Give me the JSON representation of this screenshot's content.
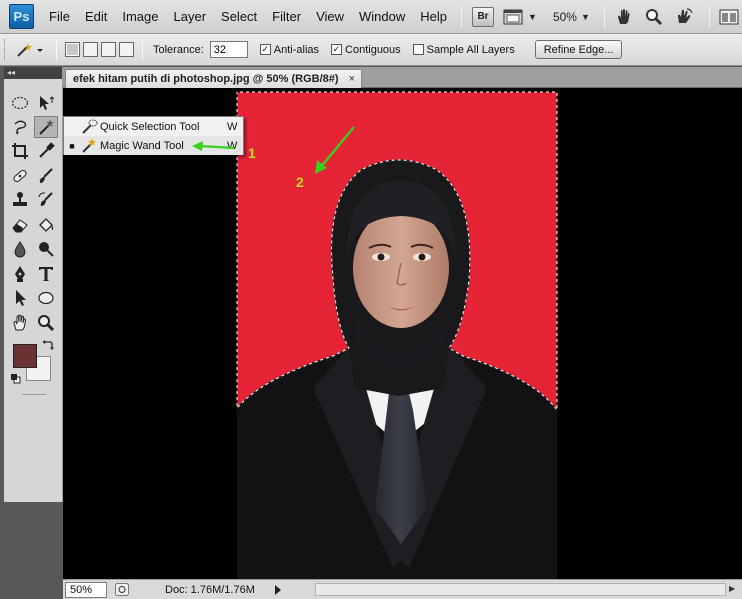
{
  "app": {
    "logo": "Ps"
  },
  "menu": [
    "File",
    "Edit",
    "Image",
    "Layer",
    "Select",
    "Filter",
    "View",
    "Window",
    "Help"
  ],
  "menubar_right": {
    "bridge_label": "Br",
    "zoom": "50%"
  },
  "options": {
    "tolerance_label": "Tolerance:",
    "tolerance_value": "32",
    "antialias_label": "Anti-alias",
    "antialias_checked": true,
    "contiguous_label": "Contiguous",
    "contiguous_checked": true,
    "sample_all_label": "Sample All Layers",
    "sample_all_checked": false,
    "refine_edge_label": "Refine Edge..."
  },
  "panel": {
    "collapse_glyph": "◂◂"
  },
  "tools": [
    "marquee-icon",
    "move-icon",
    "lasso-icon",
    "magic-wand-icon",
    "crop-icon",
    "eyedropper-icon",
    "healing-brush-icon",
    "brush-icon",
    "clone-stamp-icon",
    "history-brush-icon",
    "eraser-icon",
    "paint-bucket-icon",
    "blur-icon",
    "dodge-icon",
    "pen-icon",
    "type-icon",
    "path-selection-icon",
    "ellipse-icon",
    "hand-icon",
    "zoom-icon"
  ],
  "colors": {
    "foreground": "#6b3234",
    "background": "#f2f2f2",
    "canvas_red": "#e52536",
    "annotation_green": "#37d11c",
    "annotation_label": "#c8dc1e"
  },
  "document": {
    "tab_title": "efek hitam putih di photoshop.jpg @ 50% (RGB/8#)",
    "tab_close": "×"
  },
  "flyout": [
    {
      "label": "Quick Selection Tool",
      "shortcut": "W",
      "selected": false
    },
    {
      "label": "Magic Wand Tool",
      "shortcut": "W",
      "selected": true
    }
  ],
  "annotations": {
    "one": "1",
    "two": "2"
  },
  "status": {
    "zoom": "50%",
    "doc": "Doc: 1.76M/1.76M"
  }
}
